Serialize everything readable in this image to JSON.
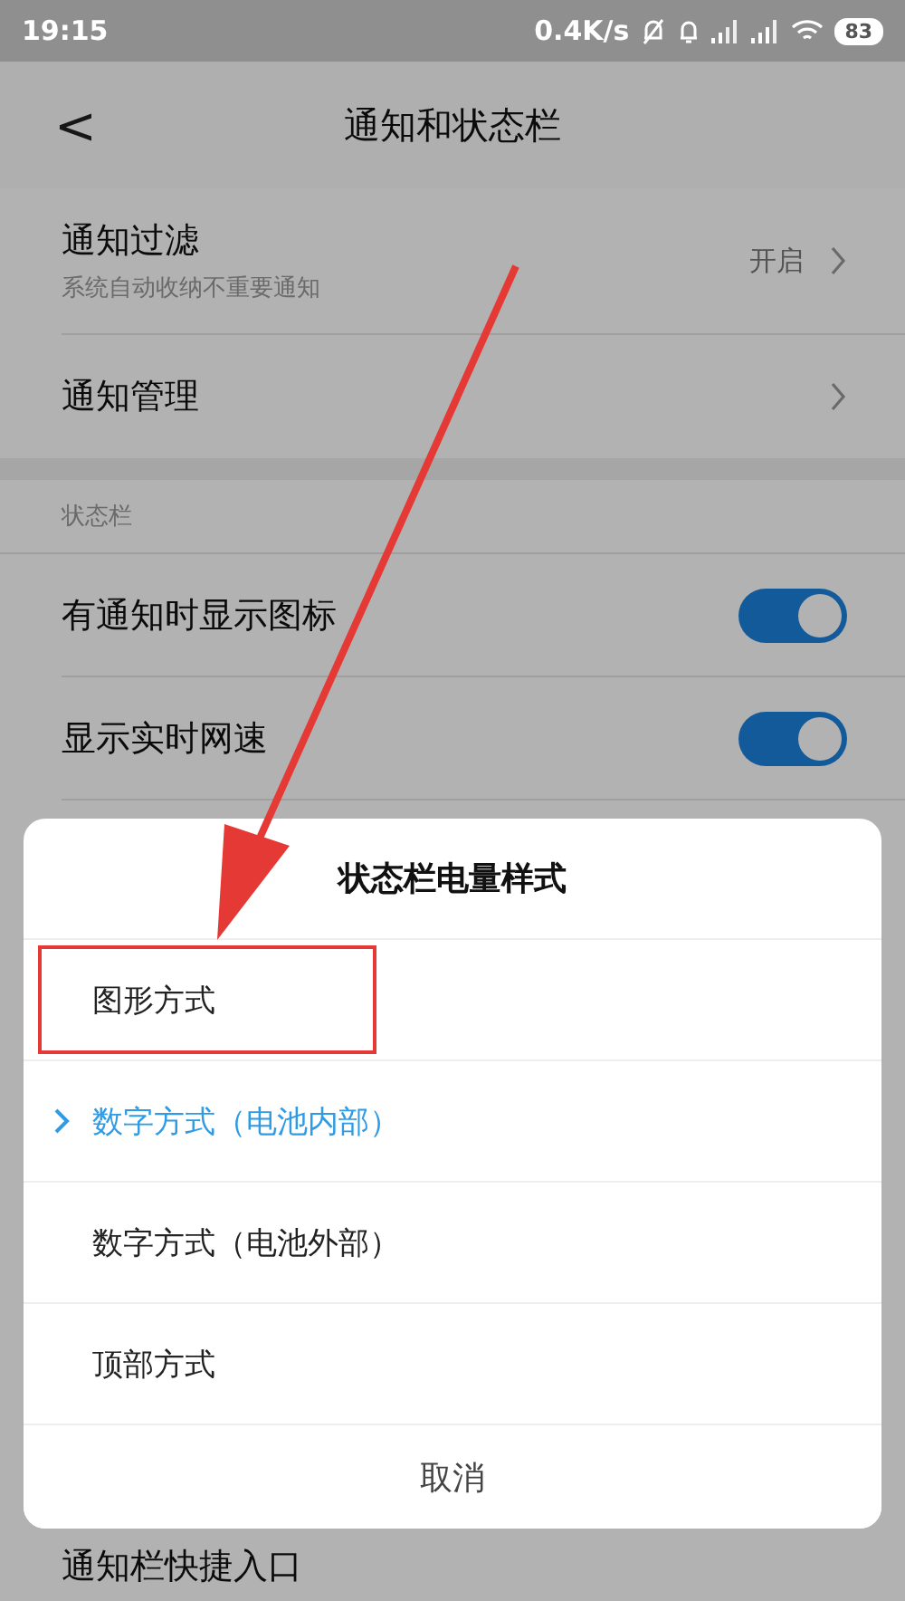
{
  "status_bar": {
    "time": "19:15",
    "net_speed": "0.4K/s",
    "battery": "83"
  },
  "header": {
    "back": "<",
    "title": "通知和状态栏"
  },
  "notification_items": [
    {
      "title": "通知过滤",
      "subtitle": "系统自动收纳不重要通知",
      "value": "开启"
    },
    {
      "title": "通知管理"
    }
  ],
  "status_section": {
    "heading": "状态栏",
    "toggles": [
      {
        "label": "有通知时显示图标",
        "on": true
      },
      {
        "label": "显示实时网速",
        "on": true
      }
    ]
  },
  "below_sheet": {
    "label": "通知栏快捷入口"
  },
  "sheet": {
    "title": "状态栏电量样式",
    "options": [
      {
        "label": "图形方式",
        "selected": false,
        "highlighted": true
      },
      {
        "label": "数字方式（电池内部）",
        "selected": true,
        "highlighted": false
      },
      {
        "label": "数字方式（电池外部）",
        "selected": false,
        "highlighted": false
      },
      {
        "label": "顶部方式",
        "selected": false,
        "highlighted": false
      }
    ],
    "cancel": "取消"
  }
}
